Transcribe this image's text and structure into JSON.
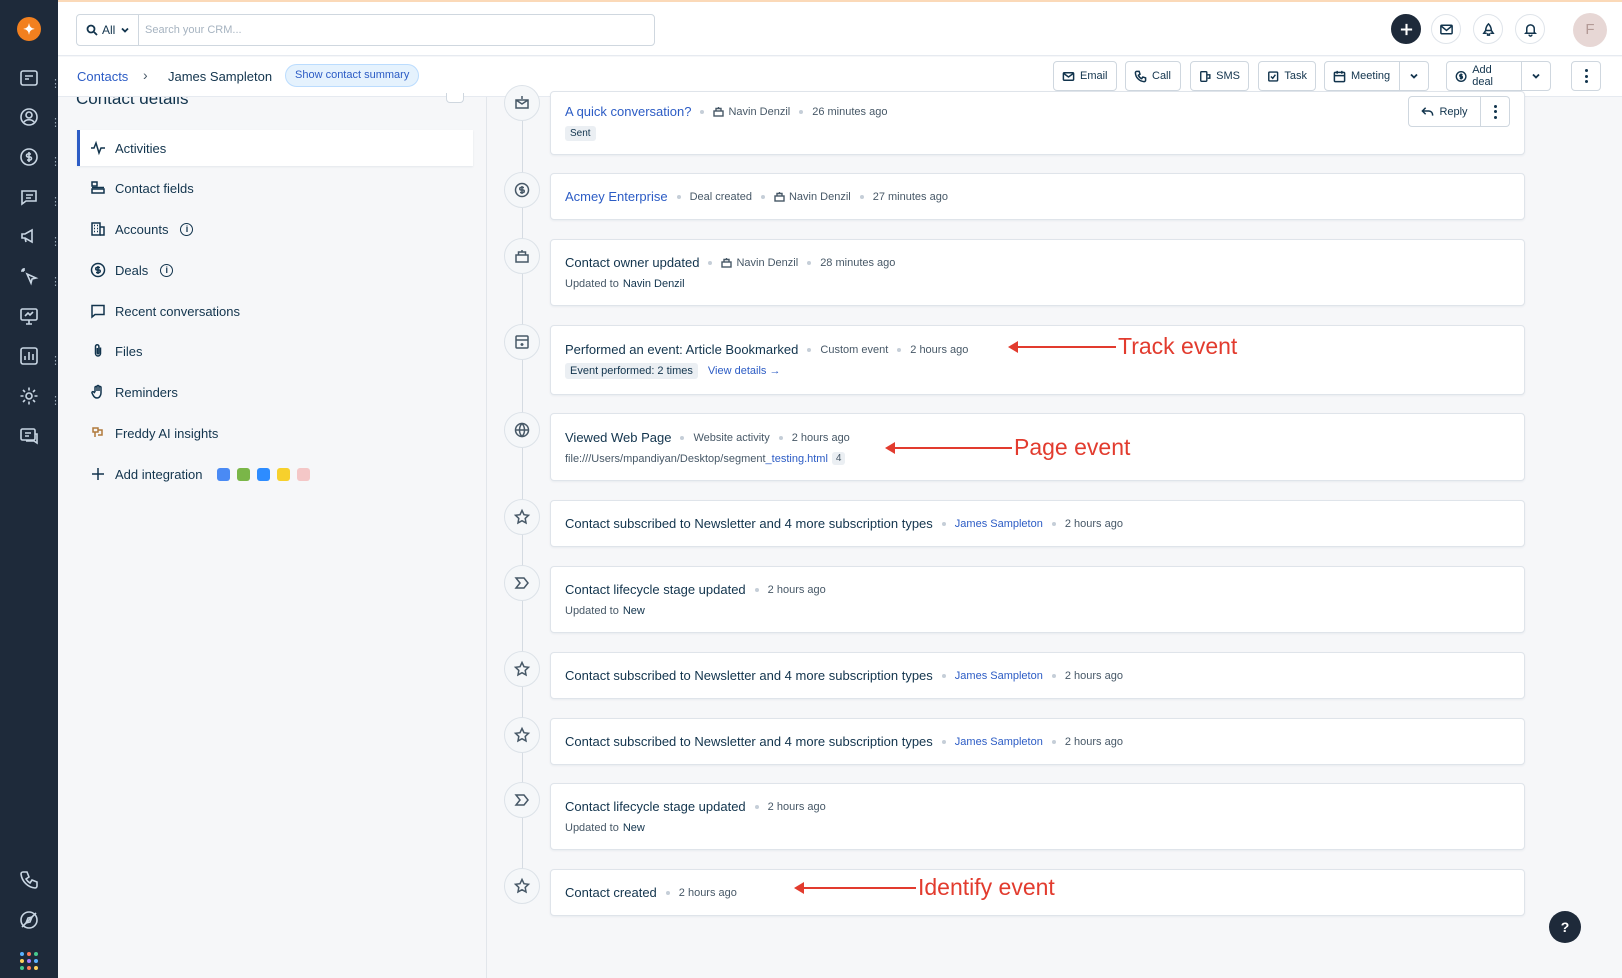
{
  "search": {
    "scope": "All",
    "placeholder": "Search your CRM..."
  },
  "header": {
    "avatar_initial": "F"
  },
  "breadcrumb": {
    "root": "Contacts",
    "current": "James Sampleton",
    "summary_pill": "Show contact summary"
  },
  "actions": {
    "email": "Email",
    "call": "Call",
    "sms": "SMS",
    "task": "Task",
    "meeting": "Meeting",
    "add_deal": "Add deal"
  },
  "left_panel": {
    "title": "Contact details",
    "items": [
      {
        "label": "Activities"
      },
      {
        "label": "Contact fields"
      },
      {
        "label": "Accounts"
      },
      {
        "label": "Deals"
      },
      {
        "label": "Recent conversations"
      },
      {
        "label": "Files"
      },
      {
        "label": "Reminders"
      },
      {
        "label": "Freddy AI insights"
      },
      {
        "label": "Add integration"
      }
    ]
  },
  "timeline": [
    {
      "icon": "email-icon",
      "title": "A quick conversation?",
      "owner": "Navin Denzil",
      "time": "26 minutes ago",
      "tag": "Sent",
      "reply": "Reply"
    },
    {
      "icon": "deal-icon",
      "title": "Acmey Enterprise",
      "meta": "Deal created",
      "owner": "Navin Denzil",
      "time": "27 minutes ago"
    },
    {
      "icon": "owner-icon",
      "title": "Contact owner updated",
      "owner": "Navin Denzil",
      "time": "28 minutes ago",
      "sub_label": "Updated to",
      "sub_value": "Navin Denzil"
    },
    {
      "icon": "calendar-event-icon",
      "title": "Performed an event: Article Bookmarked",
      "meta": "Custom event",
      "time": "2 hours ago",
      "tag": "Event performed: 2 times",
      "link": "View details →"
    },
    {
      "icon": "globe-icon",
      "title": "Viewed Web Page",
      "meta": "Website activity",
      "time": "2 hours ago",
      "url_prefix": "file:///Users/mpandiyan/Desktop/segment",
      "url_link": "_testing.html",
      "count": "4"
    },
    {
      "icon": "star-icon",
      "title": "Contact subscribed to Newsletter and 4 more subscription types",
      "person": "James Sampleton",
      "time": "2 hours ago"
    },
    {
      "icon": "lifecycle-icon",
      "title": "Contact lifecycle stage updated",
      "time": "2 hours ago",
      "sub_label": "Updated to",
      "sub_value": "New"
    },
    {
      "icon": "star-icon",
      "title": "Contact subscribed to Newsletter and 4 more subscription types",
      "person": "James Sampleton",
      "time": "2 hours ago"
    },
    {
      "icon": "star-icon",
      "title": "Contact subscribed to Newsletter and 4 more subscription types",
      "person": "James Sampleton",
      "time": "2 hours ago"
    },
    {
      "icon": "lifecycle-icon",
      "title": "Contact lifecycle stage updated",
      "time": "2 hours ago",
      "sub_label": "Updated to",
      "sub_value": "New"
    },
    {
      "icon": "star-icon",
      "title": "Contact created",
      "time": "2 hours ago"
    }
  ],
  "annotations": {
    "track": "Track event",
    "page": "Page event",
    "identify": "Identify event"
  },
  "help": {
    "label": "?"
  },
  "colors": {
    "rail": "#1e2a3a",
    "brand": "#f2801f",
    "link": "#2c5cc5",
    "annotation": "#e23b2e"
  }
}
